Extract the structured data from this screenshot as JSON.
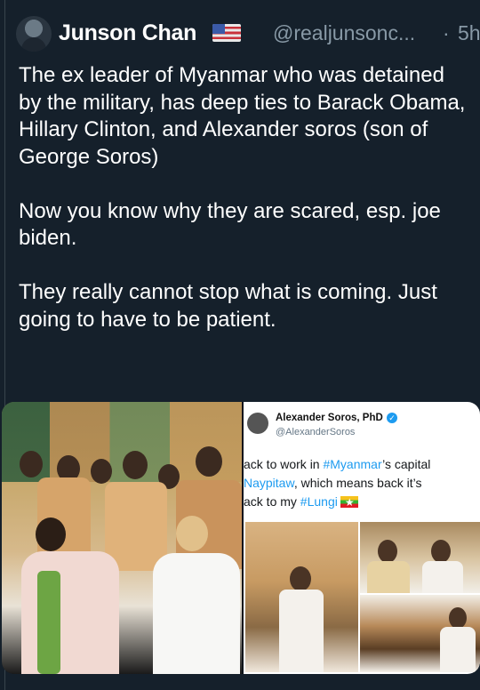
{
  "tweet": {
    "author_name": "Junson Chan",
    "author_flag_icon": "us-flag-icon",
    "handle": "@realjunsonc...",
    "separator": "·",
    "time": "5h",
    "paragraphs": [
      "The ex leader of Myanmar who was detained by the military, has deep ties to Barack Obama, Hillary Clinton, and Alexander soros (son of George Soros)",
      "Now you know why they are scared, esp. joe biden.",
      "They really cannot stop what is coming. Just going to have to be patient."
    ]
  },
  "embedded_screenshot": {
    "name": "Alexander Soros, PhD",
    "handle": "@AlexanderSoros",
    "line1_prefix": "ack to work in ",
    "line1_tag": "#Myanmar",
    "line1_suffix": "’s capital",
    "line2_tag": "Naypitaw",
    "line2_suffix": ", which means back it’s",
    "line3_prefix": "ack to my ",
    "line3_tag": "#Lungi",
    "line3_flag_icon": "myanmar-flag-icon"
  },
  "colors": {
    "background": "#15202b",
    "text": "#ffffff",
    "muted": "#8899a6",
    "link": "#1d9bf0"
  }
}
